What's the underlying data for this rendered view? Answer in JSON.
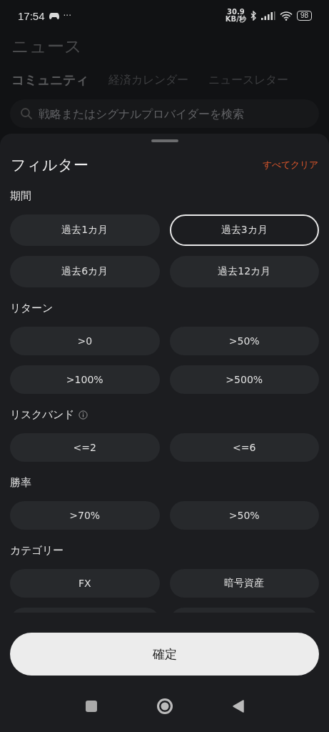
{
  "status_bar": {
    "time": "17:54",
    "ellipsis": "···",
    "speed_value": "30.9",
    "speed_unit": "KB/秒",
    "battery": "98"
  },
  "page": {
    "title": "ニュース"
  },
  "tabs": [
    {
      "label": "コミュニティ",
      "selected": true
    },
    {
      "label": "経済カレンダー",
      "selected": false
    },
    {
      "label": "ニュースレター",
      "selected": false
    }
  ],
  "search": {
    "placeholder": "戦略またはシグナルプロバイダーを検索"
  },
  "filter_sheet": {
    "title": "フィルター",
    "clear_all": "すべてクリア",
    "sections": [
      {
        "title": "期間",
        "info": false,
        "options": [
          {
            "label": "過去1カ月",
            "selected": false
          },
          {
            "label": "過去3カ月",
            "selected": true
          },
          {
            "label": "過去6カ月",
            "selected": false
          },
          {
            "label": "過去12カ月",
            "selected": false
          }
        ]
      },
      {
        "title": "リターン",
        "info": false,
        "options": [
          {
            "label": ">0",
            "selected": false
          },
          {
            "label": ">50%",
            "selected": false
          },
          {
            "label": ">100%",
            "selected": false
          },
          {
            "label": ">500%",
            "selected": false
          }
        ]
      },
      {
        "title": "リスクバンド",
        "info": true,
        "options": [
          {
            "label": "<=2",
            "selected": false
          },
          {
            "label": "<=6",
            "selected": false
          }
        ]
      },
      {
        "title": "勝率",
        "info": false,
        "options": [
          {
            "label": ">70%",
            "selected": false
          },
          {
            "label": ">50%",
            "selected": false
          }
        ]
      },
      {
        "title": "カテゴリー",
        "info": false,
        "options": [
          {
            "label": "FX",
            "selected": false
          },
          {
            "label": "暗号資産",
            "selected": false
          },
          {
            "selected": false
          },
          {
            "selected": false
          }
        ]
      }
    ],
    "confirm": "確定"
  }
}
